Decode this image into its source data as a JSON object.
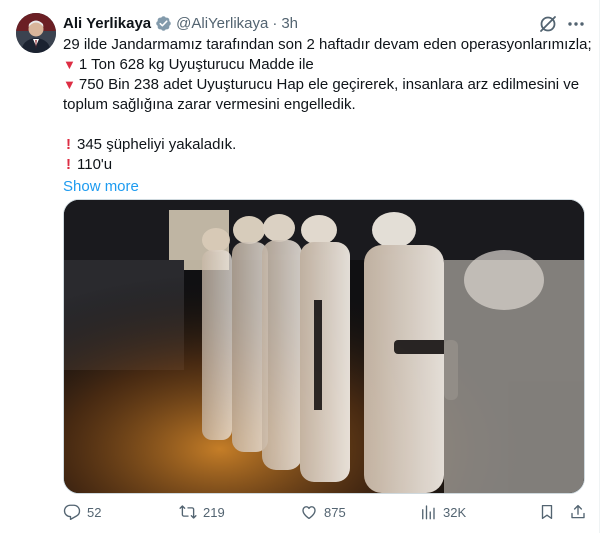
{
  "tweet": {
    "author_name": "Ali Yerlikaya",
    "handle": "@AliYerlikaya",
    "separator": "·",
    "time": "3h",
    "lines": [
      "29 ilde Jandarmamız tarafından son 2 haftadır devam eden operasyonlarımızla;",
      "1 Ton 628 kg Uyuşturucu Madde ile",
      "750 Bin 238 adet Uyuşturucu Hap ele geçirerek, insanlara arz edilmesini ve",
      "toplum sağlığına zarar vermesini engelledik.",
      "345 şüpheliyi yakaladık.",
      "110'u"
    ],
    "line_markers": [
      "",
      "▼",
      "▼",
      "",
      "!",
      "!"
    ],
    "show_more": "Show more"
  },
  "actions": {
    "replies": "52",
    "reposts": "219",
    "likes": "875",
    "views": "32K"
  },
  "icons": [
    "verified-badge-icon",
    "grok-icon",
    "more-icon",
    "reply-icon",
    "repost-icon",
    "like-icon",
    "views-icon",
    "bookmark-icon",
    "share-icon"
  ],
  "colors": {
    "link": "#1d9bf0",
    "verified": "#829aab",
    "muted": "#536471",
    "marker": "#dd2e44"
  }
}
